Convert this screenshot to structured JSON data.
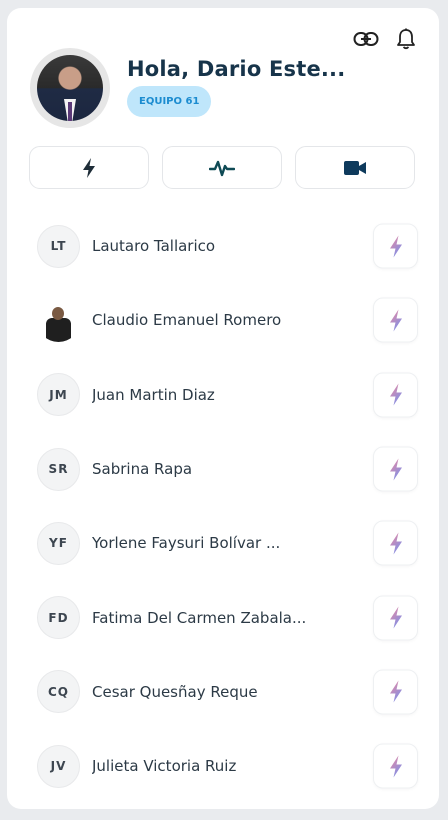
{
  "header": {
    "greeting": "Hola, Dario Este...",
    "team_badge": "EQUIPO 61",
    "icons": [
      "link-icon",
      "bell-icon"
    ]
  },
  "tabs": [
    {
      "icon": "bolt-icon"
    },
    {
      "icon": "activity-icon"
    },
    {
      "icon": "video-icon"
    }
  ],
  "members": [
    {
      "initials": "LT",
      "name": "Lautaro Tallarico"
    },
    {
      "initials": "",
      "name": "Claudio Emanuel Romero",
      "has_photo": true
    },
    {
      "initials": "JM",
      "name": "Juan Martin Diaz"
    },
    {
      "initials": "SR",
      "name": "Sabrina Rapa"
    },
    {
      "initials": "YF",
      "name": "Yorlene Faysuri Bolívar ..."
    },
    {
      "initials": "FD",
      "name": "Fatima Del Carmen Zabala..."
    },
    {
      "initials": "CQ",
      "name": "Cesar Quesñay Reque"
    },
    {
      "initials": "JV",
      "name": "Julieta Victoria Ruiz"
    }
  ],
  "colors": {
    "title": "#17344a",
    "badge_bg": "#bfe6fb",
    "badge_text": "#1c8cd0",
    "bolt_gradient_start": "#f38a9c",
    "bolt_gradient_end": "#7d8fe8"
  }
}
